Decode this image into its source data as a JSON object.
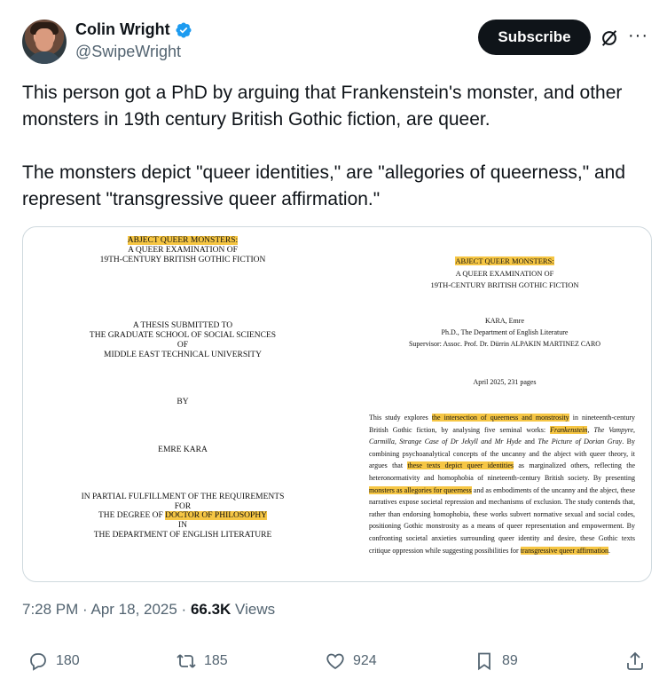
{
  "author": {
    "name": "Colin Wright",
    "handle": "@SwipeWright"
  },
  "header": {
    "subscribe_label": "Subscribe"
  },
  "tweet": {
    "paragraphs": [
      "This person got a PhD by arguing that Frankenstein's monster, and other monsters in 19th century British Gothic fiction, are queer.",
      "The monsters depict \"queer identities,\" are \"allegories of queerness,\" and represent \"transgressive queer affirmation.\""
    ]
  },
  "image": {
    "left": {
      "title": "ABJECT QUEER MONSTERS:",
      "subtitle1": "A QUEER EXAMINATION OF",
      "subtitle2": "19TH-CENTURY BRITISH GOTHIC FICTION",
      "thesis1": "A THESIS SUBMITTED TO",
      "thesis2": "THE GRADUATE SCHOOL OF SOCIAL SCIENCES",
      "thesis3": "OF",
      "thesis4": "MIDDLE EAST TECHNICAL UNIVERSITY",
      "by": "BY",
      "author": "EMRE KARA",
      "fulfill1": "IN PARTIAL FULFILLMENT OF THE REQUIREMENTS",
      "fulfill2": "FOR",
      "degree_prefix": "THE DEGREE OF ",
      "degree": "DOCTOR OF PHILOSOPHY",
      "in": "IN",
      "dept": "THE DEPARTMENT OF ENGLISH LITERATURE"
    },
    "right": {
      "title": "ABJECT QUEER MONSTERS:",
      "subtitle1": "A QUEER EXAMINATION OF",
      "subtitle2": "19TH-CENTURY BRITISH GOTHIC FICTION",
      "author": "KARA, Emre",
      "program": "Ph.D., The Department of English Literature",
      "supervisor": "Supervisor: Assoc. Prof. Dr. Dürrin ALPAKIN MARTINEZ CARO",
      "date": "April 2025, 231 pages",
      "abstract_parts": [
        {
          "t": "This study explores ",
          "h": false
        },
        {
          "t": "the intersection of queerness and monstrosity",
          "h": true
        },
        {
          "t": " in nineteenth-century British Gothic fiction, by analysing five seminal works: ",
          "h": false
        },
        {
          "t": "Frankenstein",
          "h": true,
          "i": true
        },
        {
          "t": ", The Vampyre, Carmilla, Strange Case of Dr Jekyll and Mr Hyde",
          "h": false,
          "i": true
        },
        {
          "t": " and ",
          "h": false
        },
        {
          "t": "The Picture of Dorian Gray",
          "h": false,
          "i": true
        },
        {
          "t": ". By combining psychoanalytical concepts of the uncanny and the abject with queer theory, it argues that ",
          "h": false
        },
        {
          "t": "these texts depict queer identities",
          "h": true
        },
        {
          "t": " as marginalized others, reflecting the heteronormativity and homophobia of nineteenth-century British society. By presenting ",
          "h": false
        },
        {
          "t": "monsters as allegories for queerness",
          "h": true
        },
        {
          "t": " and as embodiments of the uncanny and the abject, these narratives expose societal repression and mechanisms of exclusion. The study contends that, rather than endorsing homophobia, these works subvert normative sexual and social codes, positioning Gothic monstrosity as a means of queer representation and empowerment. By confronting societal anxieties surrounding queer identity and desire, these Gothic texts critique oppression while suggesting possibilities for ",
          "h": false
        },
        {
          "t": "transgressive queer affirmation",
          "h": true
        },
        {
          "t": ".",
          "h": false
        }
      ]
    }
  },
  "meta": {
    "time": "7:28 PM · Apr 18, 2025 · ",
    "views_count": "66.3K",
    "views_label": " Views"
  },
  "actions": {
    "replies": "180",
    "reposts": "185",
    "likes": "924",
    "bookmarks": "89"
  },
  "icons": [
    "verified-badge-icon",
    "grok-icon",
    "more-icon",
    "reply-icon",
    "repost-icon",
    "like-icon",
    "bookmark-icon",
    "share-icon"
  ],
  "colors": {
    "verified": "#1d9bf0",
    "highlight": "#f6c644",
    "muted": "#536471"
  }
}
